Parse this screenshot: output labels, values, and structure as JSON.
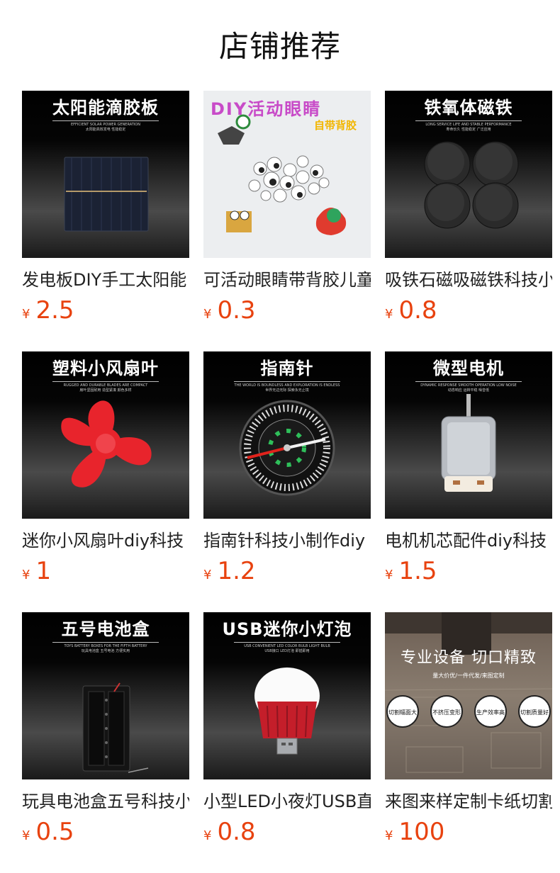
{
  "page": {
    "title": "店铺推荐"
  },
  "colors": {
    "price": "#e8420f",
    "text": "#222222"
  },
  "products": [
    {
      "name": "发电板DIY手工太阳能",
      "currency": "¥",
      "price": "2.5",
      "image": {
        "title": "太阳能滴胶板",
        "subtitle": "EFFICIENT SOLAR POWER GENERATION",
        "subtitle2": "太阳能高效发电 性能稳定",
        "icon": "solar-panel-icon"
      }
    },
    {
      "name": "可活动眼睛带背胶儿童",
      "currency": "¥",
      "price": "0.3",
      "image": {
        "title": "DIY活动眼睛",
        "tag": "自带背胶",
        "icon": "googly-eyes-icon"
      }
    },
    {
      "name": "吸铁石磁吸磁铁科技小",
      "currency": "¥",
      "price": "0.8",
      "image": {
        "title": "铁氧体磁铁",
        "subtitle": "LONG SERVICE LIFE AND STABLE PERFORMANCE",
        "subtitle2": "寿命长久 性能稳定 广泛应用",
        "icon": "magnet-discs-icon"
      }
    },
    {
      "name": "迷你小风扇叶diy科技",
      "currency": "¥",
      "price": "1",
      "image": {
        "title": "塑料小风扇叶",
        "subtitle": "RUGGED AND DURABLE BLADES ARE COMPACT",
        "subtitle2": "扇叶坚固耐用 造型紧凑 颜色多样",
        "icon": "fan-blade-icon"
      }
    },
    {
      "name": "指南针科技小制作diy",
      "currency": "¥",
      "price": "1.2",
      "image": {
        "title": "指南针",
        "subtitle": "THE WORLD IS BOUNDLESS AND EXPLORATION IS ENDLESS",
        "subtitle2": "世界无边无际 探索永无止境",
        "icon": "compass-icon"
      }
    },
    {
      "name": "电机机芯配件diy科技",
      "currency": "¥",
      "price": "1.5",
      "image": {
        "title": "微型电机",
        "subtitle": "DYNAMIC RESPONSE SMOOTH OPERATION LOW NOISE",
        "subtitle2": "动态响应 运转平稳 噪音低",
        "icon": "motor-icon"
      }
    },
    {
      "name": "玩具电池盒五号科技小",
      "currency": "¥",
      "price": "0.5",
      "image": {
        "title": "五号电池盒",
        "subtitle": "TOYS BATTERY BOXES FOR THE FIFTH BATTERY",
        "subtitle2": "玩具电池盒 五号电池 方便实用",
        "icon": "battery-box-icon"
      }
    },
    {
      "name": "小型LED小夜灯USB直插",
      "currency": "¥",
      "price": "0.8",
      "image": {
        "title": "USB迷你小灯泡",
        "subtitle": "USB CONVENIENT LED COLOR BULB LIGHT BULB",
        "subtitle2": "USB接口 LED灯泡 即插即用",
        "icon": "usb-bulb-icon"
      }
    },
    {
      "name": "来图来样定制卡纸切割",
      "currency": "¥",
      "price": "100",
      "image": {
        "title": "专业设备 切口精致",
        "subtitle": "量大价优/一件代发/来图定制",
        "badges": [
          "切割幅面大",
          "不挤压变形",
          "生产效率高",
          "切割质量好"
        ],
        "icon": "cutting-machine-icon"
      }
    }
  ]
}
